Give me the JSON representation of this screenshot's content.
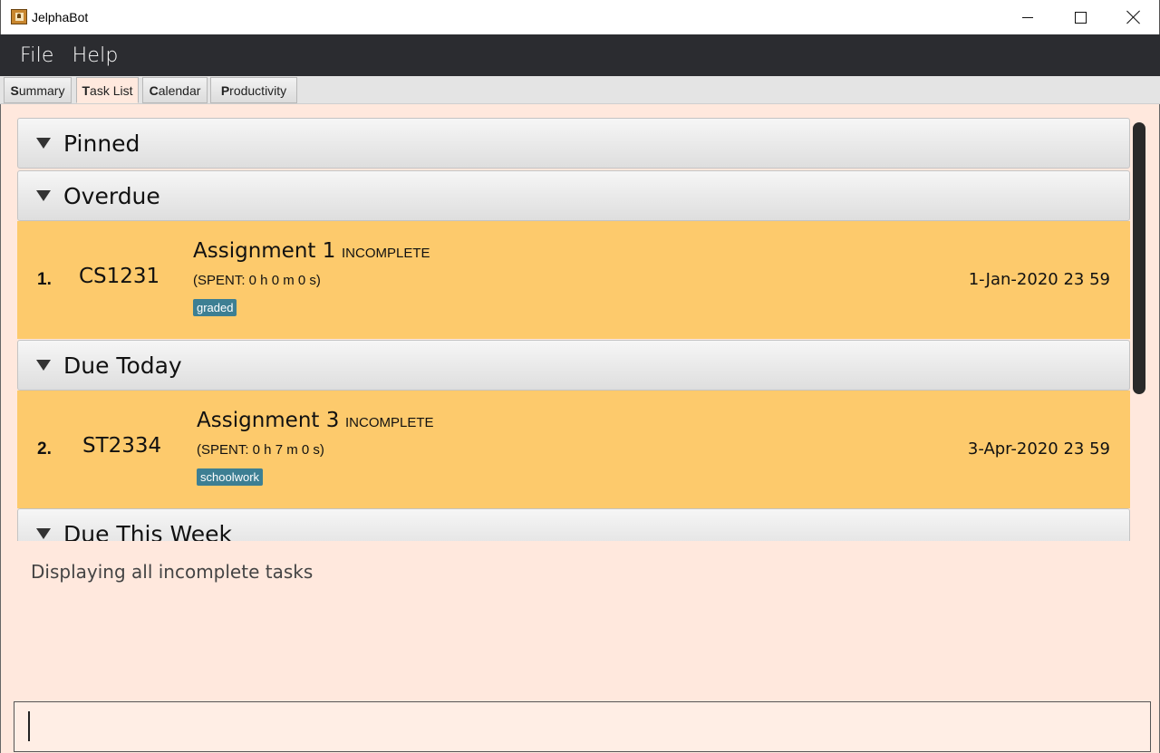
{
  "window": {
    "title": "JelphaBot"
  },
  "menu": {
    "items": [
      "File",
      "Help"
    ]
  },
  "tabs": [
    {
      "label": "Summary",
      "hotkey": "S",
      "rest": "ummary",
      "active": false
    },
    {
      "label": "Task List",
      "hotkey": "T",
      "rest": "ask List",
      "active": true
    },
    {
      "label": "Calendar",
      "hotkey": "C",
      "rest": "alendar",
      "active": false
    },
    {
      "label": "Productivity",
      "hotkey": "P",
      "rest": "roductivity",
      "active": false
    }
  ],
  "sections": [
    {
      "title": "Pinned"
    },
    {
      "title": "Overdue"
    },
    {
      "title": "Due Today"
    },
    {
      "title": "Due This Week"
    }
  ],
  "tasks": [
    {
      "index": "1.",
      "module": "CS1231",
      "name": "Assignment 1",
      "status": "INCOMPLETE",
      "spent": "(SPENT: 0 h 0 m 0 s)",
      "tag": "graded",
      "deadline": "1-Jan-2020 23 59"
    },
    {
      "index": "2.",
      "module": "ST2334",
      "name": "Assignment 3",
      "status": "INCOMPLETE",
      "spent": "(SPENT: 0 h 7 m 0 s)",
      "tag": "schoolwork",
      "deadline": "3-Apr-2020 23 59"
    }
  ],
  "result": {
    "message": "Displaying all incomplete tasks"
  },
  "command": {
    "value": ""
  },
  "colors": {
    "task_card": "#fdca6c",
    "tag": "#3d7f93",
    "background": "#ffe8dd",
    "menubar": "#2b2c30"
  }
}
